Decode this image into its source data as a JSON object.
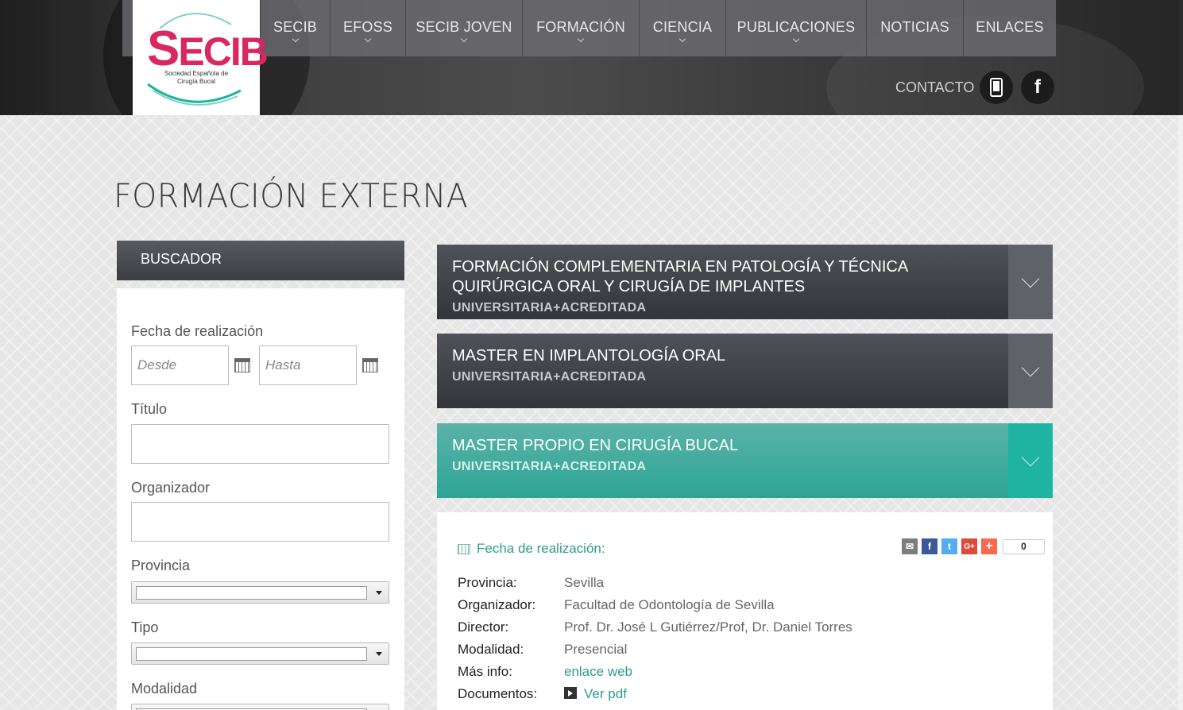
{
  "brand": {
    "logo_text": "SECIB",
    "logo_subtitle": "Sociedad Española de Cirugía Bucal"
  },
  "nav": {
    "items": [
      {
        "label": "SECIB",
        "has_dropdown": true
      },
      {
        "label": "EFOSS",
        "has_dropdown": true
      },
      {
        "label": "SECIB JOVEN",
        "has_dropdown": true
      },
      {
        "label": "FORMACIÓN",
        "has_dropdown": true
      },
      {
        "label": "CIENCIA",
        "has_dropdown": true
      },
      {
        "label": "PUBLICACIONES",
        "has_dropdown": true
      },
      {
        "label": "NOTICIAS",
        "has_dropdown": false
      },
      {
        "label": "ENLACES",
        "has_dropdown": false
      }
    ],
    "contact_label": "CONTACTO",
    "icons": [
      "phone-icon",
      "facebook-icon"
    ]
  },
  "page": {
    "title": "FORMACIÓN EXTERNA"
  },
  "search": {
    "header": "BUSCADOR",
    "date_label": "Fecha de realización",
    "from_placeholder": "Desde",
    "to_placeholder": "Hasta",
    "title_label": "Título",
    "title_value": "",
    "organizer_label": "Organizador",
    "organizer_value": "",
    "province_label": "Provincia",
    "province_value": "",
    "type_label": "Tipo",
    "type_value": "",
    "modality_label": "Modalidad"
  },
  "courses": [
    {
      "title": "FORMACIÓN COMPLEMENTARIA EN PATOLOGÍA Y TÉCNICA QUIRÚRGICA ORAL Y CIRUGÍA DE IMPLANTES",
      "subtitle": "UNIVERSITARIA+ACREDITADA",
      "expanded": false
    },
    {
      "title": "MASTER EN IMPLANTOLOGÍA ORAL",
      "subtitle": "UNIVERSITARIA+ACREDITADA",
      "expanded": false
    },
    {
      "title": "MASTER PROPIO EN CIRUGÍA BUCAL",
      "subtitle": "UNIVERSITARIA+ACREDITADA",
      "expanded": true
    }
  ],
  "detail": {
    "date_label": "Fecha de realización:",
    "share_count": "0",
    "share_buttons": [
      {
        "icon": "email-icon",
        "glyph": "✉",
        "color": "#7d7d7d"
      },
      {
        "icon": "facebook-share-icon",
        "glyph": "f",
        "color": "#3b5998"
      },
      {
        "icon": "twitter-share-icon",
        "glyph": "t",
        "color": "#55acee"
      },
      {
        "icon": "googleplus-share-icon",
        "glyph": "G+",
        "color": "#dd4b39"
      },
      {
        "icon": "addthis-icon",
        "glyph": "+",
        "color": "#f8694d"
      }
    ],
    "fields": {
      "province_key": "Provincia:",
      "province_val": "Sevilla",
      "organizer_key": "Organizador:",
      "organizer_val": "Facultad de Odontología de Sevilla",
      "director_key": "Director:",
      "director_val": "Prof. Dr. José L Gutiérrez/Prof, Dr. Daniel Torres",
      "modality_key": "Modalidad:",
      "modality_val": "Presencial",
      "moreinfo_key": "Más info:",
      "moreinfo_val": "enlace web",
      "docs_key": "Documentos:",
      "docs_val": "Ver pdf"
    }
  },
  "colors": {
    "accent": "#2da496",
    "brand": "#d9285f",
    "dark_bar": "#3b3d42"
  }
}
